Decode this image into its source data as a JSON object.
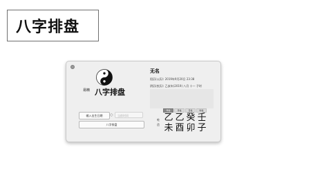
{
  "slide_title": "八字排盘",
  "app": {
    "logo_small_label": "易精",
    "name": "八字排盘",
    "input_time_button": "输入出生日期",
    "stepper_symbol": "◇",
    "now_field_placeholder": "当前时间",
    "bazi_button": "八字排盘"
  },
  "chart": {
    "person_name": "无名",
    "solar_line": "阳历(公历): 2019年9月20日 23:38",
    "lunar_line": "阴历(农历): 乙亥年(2019) 八月 十一 子时",
    "columns": [
      "年柱",
      "月柱",
      "日柱",
      "时柱"
    ],
    "row_label": "乾造",
    "stems": [
      "乙",
      "乙",
      "癸",
      "壬"
    ],
    "branches": [
      "未",
      "酉",
      "卯",
      "子"
    ]
  }
}
